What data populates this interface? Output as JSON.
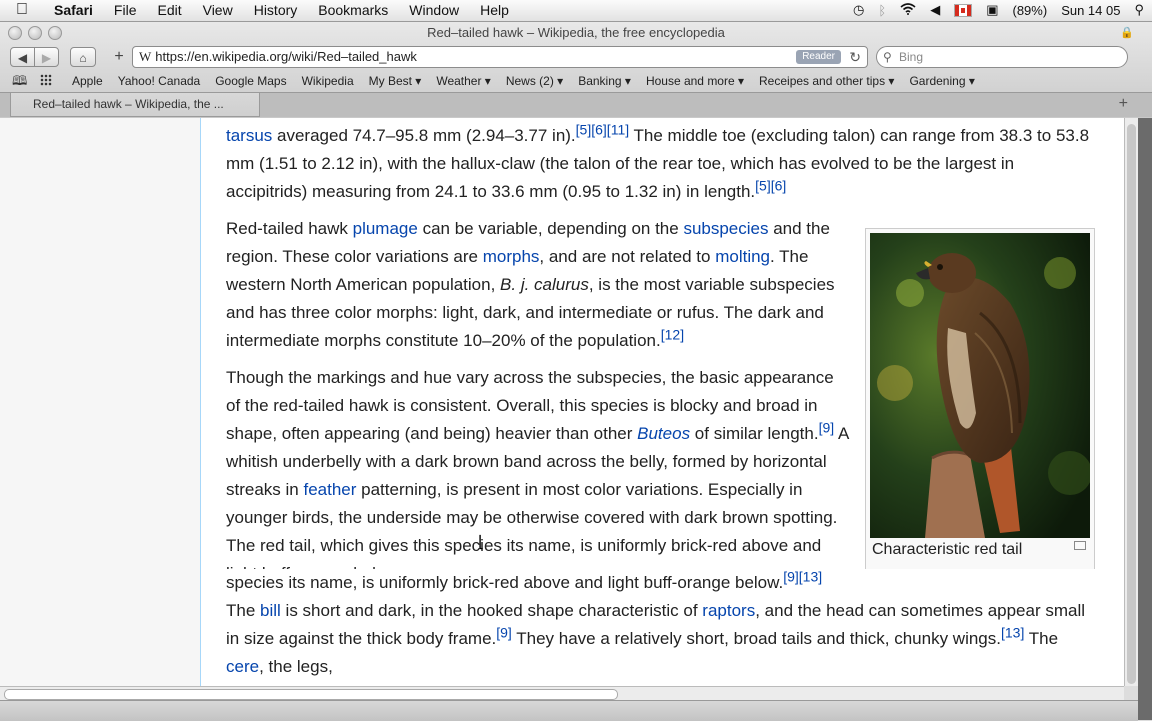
{
  "menubar": {
    "app": "Safari",
    "items": [
      "File",
      "Edit",
      "View",
      "History",
      "Bookmarks",
      "Window",
      "Help"
    ],
    "battery": "(89%)",
    "clock": "Sun 14 05"
  },
  "window": {
    "title": "Red–tailed hawk – Wikipedia, the free encyclopedia"
  },
  "toolbar": {
    "url": "https://en.wikipedia.org/wiki/Red–tailed_hawk",
    "url_icon": "W",
    "reader_label": "Reader",
    "search_placeholder": "Bing"
  },
  "bookmarks": [
    "Apple",
    "Yahoo! Canada",
    "Google Maps",
    "Wikipedia",
    "My Best ▾",
    "Weather ▾",
    "News (2) ▾",
    "Banking ▾",
    "House and more ▾",
    "Receipes and other tips ▾",
    "Gardening ▾"
  ],
  "tab": {
    "label": "Red–tailed hawk – Wikipedia, the ..."
  },
  "article": {
    "p1": {
      "link_tarsus": "tarsus",
      "t1": " averaged 74.7–95.8 mm (2.94–3.77 in).",
      "ref1": "[5][6][11]",
      "t2": " The middle toe (excluding talon) can range from 38.3 to 53.8 mm (1.51 to 2.12 in), with the hallux-claw (the talon of the rear toe, which has evolved to be the largest in accipitrids) measuring from 24.1 to 33.6 mm (0.95 to 1.32 in) in length.",
      "ref2": "[5][6]"
    },
    "p2": {
      "t1": "Red-tailed hawk ",
      "link_plumage": "plumage",
      "t2": " can be variable, depending on the ",
      "link_subspecies": "subspecies",
      "t3": " and the region. These color variations are ",
      "link_morphs": "morphs",
      "t4": ", and are not related to ",
      "link_molting": "molting",
      "t5": ". The western North American population, ",
      "italic": "B. j. calurus",
      "t6": ", is the most variable subspecies and has three color morphs: light, dark, and intermediate or rufus. The dark and intermediate morphs constitute 10–20% of the population.",
      "ref": "[12]"
    },
    "p3": {
      "t1": "Though the markings and hue vary across the subspecies, the basic appearance of the red-tailed hawk is consistent. Overall, this species is blocky and broad in shape, often appearing (and being) heavier than other ",
      "link_buteos": "Buteos",
      "t2": " of similar length.",
      "ref1": "[9]",
      "t3": " A whitish underbelly with a dark brown band across the belly, formed by horizontal streaks in ",
      "link_feather": "feather",
      "t4": " patterning, is present in most color variations. Especially in younger birds, the underside may be otherwise covered with dark brown spotting. The red tail, which gives this species its name, is uniformly brick-red above and light buff-orange below.",
      "ref2": "[9][13]",
      "t5": " The ",
      "link_bill": "bill",
      "t6": " is short and dark, in the hooked shape characteristic of ",
      "link_raptors": "raptors",
      "t7": ", and the head can sometimes appear small in size against the thick body frame.",
      "ref3": "[9]",
      "t8": " They have a relatively short, broad tails and thick, chunky wings.",
      "ref4": "[13]",
      "t9": " The ",
      "link_cere": "cere",
      "t10": ", the legs,"
    },
    "image_caption": "Characteristic red tail"
  },
  "icons": {
    "apple": "apple-icon",
    "time_machine": "clock-icon",
    "bluetooth": "bluetooth-icon",
    "wifi": "wifi-icon",
    "volume": "volume-icon",
    "spotlight": "search-icon"
  }
}
